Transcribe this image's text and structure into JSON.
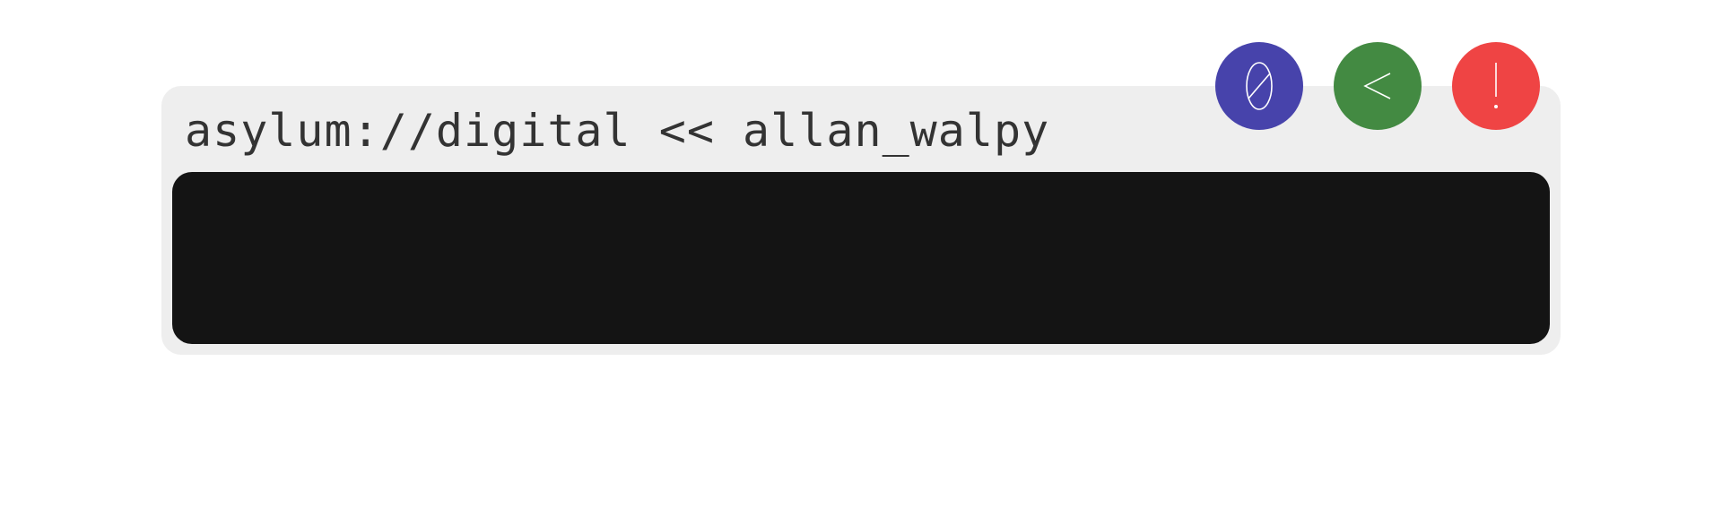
{
  "terminal": {
    "title": "asylum://digital << allan_walpy"
  },
  "controls": [
    {
      "icon": "zero-icon",
      "glyph": "0",
      "color": "#4743ab"
    },
    {
      "icon": "back-chevron-icon",
      "glyph": "<",
      "color": "#438a42"
    },
    {
      "icon": "exclamation-icon",
      "glyph": "!",
      "color": "#ef4444"
    }
  ],
  "colors": {
    "window_bg": "#eeeeee",
    "screen_bg": "#141414",
    "title_text": "#333333",
    "icon_stroke": "#ffffff"
  }
}
